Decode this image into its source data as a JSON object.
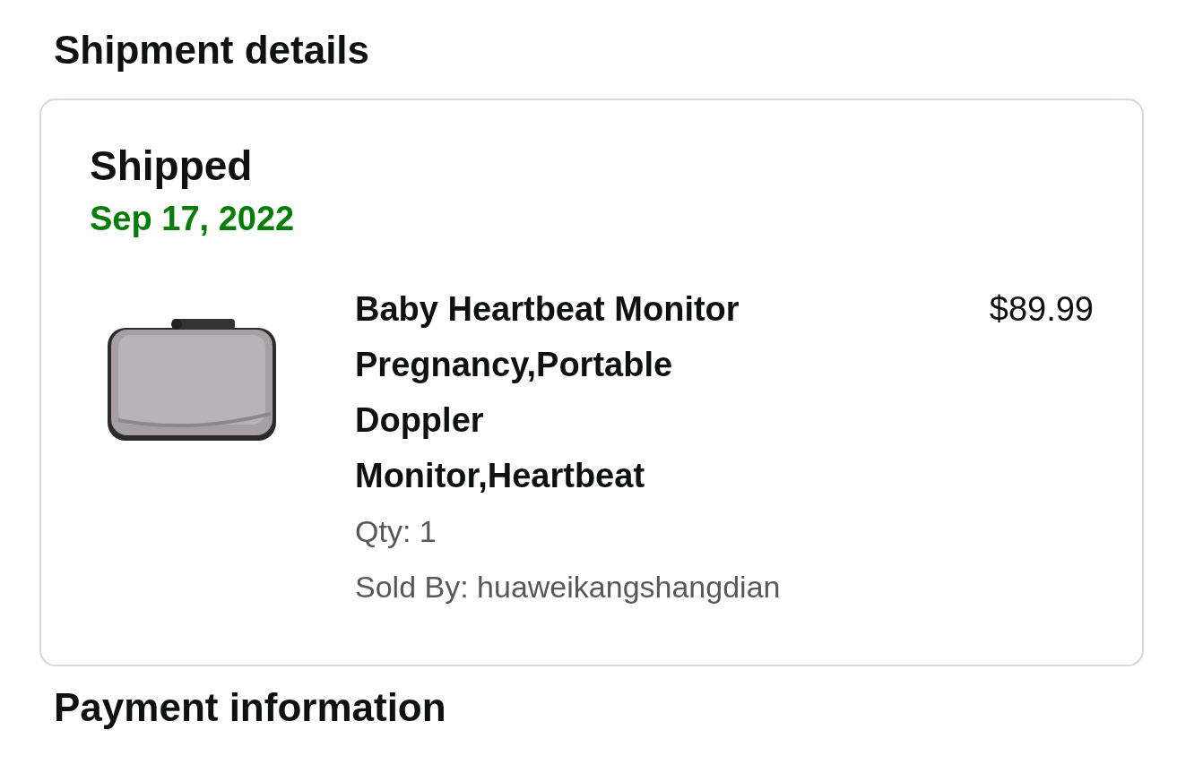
{
  "heading": "Shipment details",
  "shipment": {
    "status": "Shipped",
    "date": "Sep 17, 2022",
    "item": {
      "title": "Baby Heartbeat Monitor Pregnancy,Portable Doppler Monitor,Heartbeat",
      "price": "$89.99",
      "quantity": "Qty: 1",
      "seller": "Sold By: huaweikangshangdian"
    }
  },
  "next_heading": "Payment information"
}
